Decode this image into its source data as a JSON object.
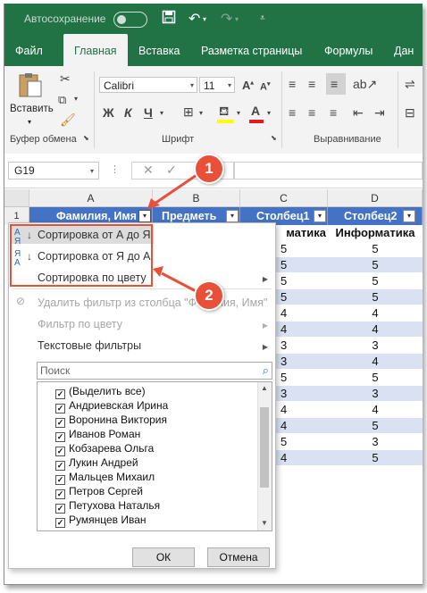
{
  "titlebar": {
    "autosave": "Автосохранение",
    "toggle_state": "off"
  },
  "tabs": [
    {
      "label": "Файл"
    },
    {
      "label": "Главная"
    },
    {
      "label": "Вставка"
    },
    {
      "label": "Разметка страницы"
    },
    {
      "label": "Формулы"
    },
    {
      "label": "Дан"
    }
  ],
  "ribbon": {
    "paste_label": "Вставить",
    "clipboard_group": "Буфер обмена",
    "font_group": "Шрифт",
    "alignment_group": "Выравнивание",
    "font_name": "Calibri",
    "font_size": "11",
    "bold": "Ж",
    "italic": "К",
    "underline": "Ч"
  },
  "formula_bar": {
    "name_box": "G19",
    "formula": ""
  },
  "columns": [
    "A",
    "B",
    "C",
    "D"
  ],
  "rows": [
    "1"
  ],
  "table_header": [
    "Фамилия, Имя",
    "Предметь",
    "Столбец1",
    "Столбец2"
  ],
  "visible_col_c_header": "матика",
  "visible_col_d_header": "Информатика",
  "col_c_values": [
    "5",
    "5",
    "5",
    "5",
    "4",
    "4",
    "3",
    "3",
    "5",
    "3",
    "4",
    "4",
    "5",
    "4"
  ],
  "col_d_values": [
    "5",
    "5",
    "5",
    "5",
    "4",
    "4",
    "3",
    "4",
    "5",
    "3",
    "4",
    "5",
    "3",
    "5"
  ],
  "menu": {
    "sort_az": "Сортировка от А до Я",
    "sort_za": "Сортировка от Я до А",
    "sort_color": "Сортировка по цвету",
    "remove_filter": "Удалить фильтр из столбца \"Фамилия, Имя\"",
    "filter_color": "Фильтр по цвету",
    "text_filters": "Текстовые фильтры",
    "search_placeholder": "Поиск",
    "items": [
      "(Выделить все)",
      "Андриевская Ирина",
      "Воронина Виктория",
      "Иванов Роман",
      "Кобзарева Ольга",
      "Лукин Андрей",
      "Мальцев Михаил",
      "Петров Сергей",
      "Петухова Наталья",
      "Румянцев Иван"
    ],
    "ok": "ОК",
    "cancel": "Отмена"
  },
  "callouts": [
    "1",
    "2"
  ],
  "colors": {
    "excel_green": "#217346",
    "header_blue": "#4472c4",
    "band_blue": "#d9e1f2",
    "annotation_red": "#e8503a"
  }
}
